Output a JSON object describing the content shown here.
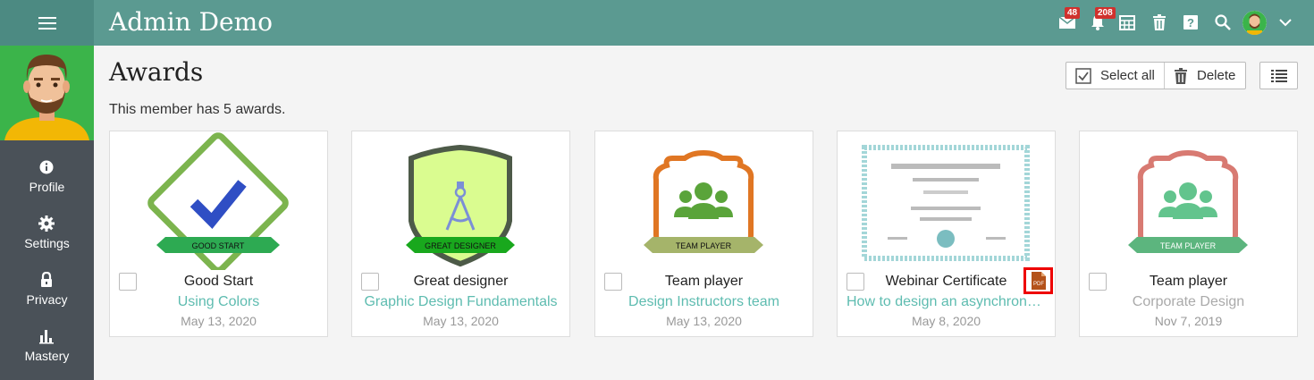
{
  "app": {
    "title": "Admin Demo"
  },
  "topbar": {
    "messages_badge": "48",
    "notifications_badge": "208",
    "icons": [
      "menu-icon",
      "mail-icon",
      "bell-icon",
      "calendar-icon",
      "trash-icon",
      "help-icon",
      "search-icon",
      "avatar",
      "chevron-down-icon"
    ]
  },
  "sidebar": {
    "items": [
      {
        "label": "Profile",
        "icon": "info-icon"
      },
      {
        "label": "Settings",
        "icon": "gear-icon"
      },
      {
        "label": "Privacy",
        "icon": "lock-icon"
      },
      {
        "label": "Mastery",
        "icon": "bar-chart-icon"
      }
    ]
  },
  "page": {
    "title": "Awards",
    "subtitle": "This member has 5 awards."
  },
  "toolbar": {
    "select_all": "Select all",
    "delete": "Delete"
  },
  "awards": [
    {
      "title": "Good Start",
      "link": "Using Colors",
      "date": "May 13, 2020",
      "ribbon": "GOOD START",
      "link_muted": false
    },
    {
      "title": "Great designer",
      "link": "Graphic Design Fundamentals",
      "date": "May 13, 2020",
      "ribbon": "GREAT DESIGNER",
      "link_muted": false
    },
    {
      "title": "Team player",
      "link": "Design Instructors team",
      "date": "May 13, 2020",
      "ribbon": "TEAM PLAYER",
      "link_muted": false
    },
    {
      "title": "Webinar Certificate",
      "link": "How to design an asynchronous course",
      "date": "May 8, 2020",
      "ribbon": "",
      "pdf_label": "PDF",
      "link_muted": false
    },
    {
      "title": "Team player",
      "link": "Corporate Design",
      "date": "Nov 7, 2019",
      "ribbon": "TEAM PLAYER",
      "link_muted": true
    }
  ],
  "colors": {
    "topbar": "#5b9a91",
    "sidebar": "#4a5158",
    "link": "#5ebcb0",
    "accent_green": "#3bb44a"
  }
}
